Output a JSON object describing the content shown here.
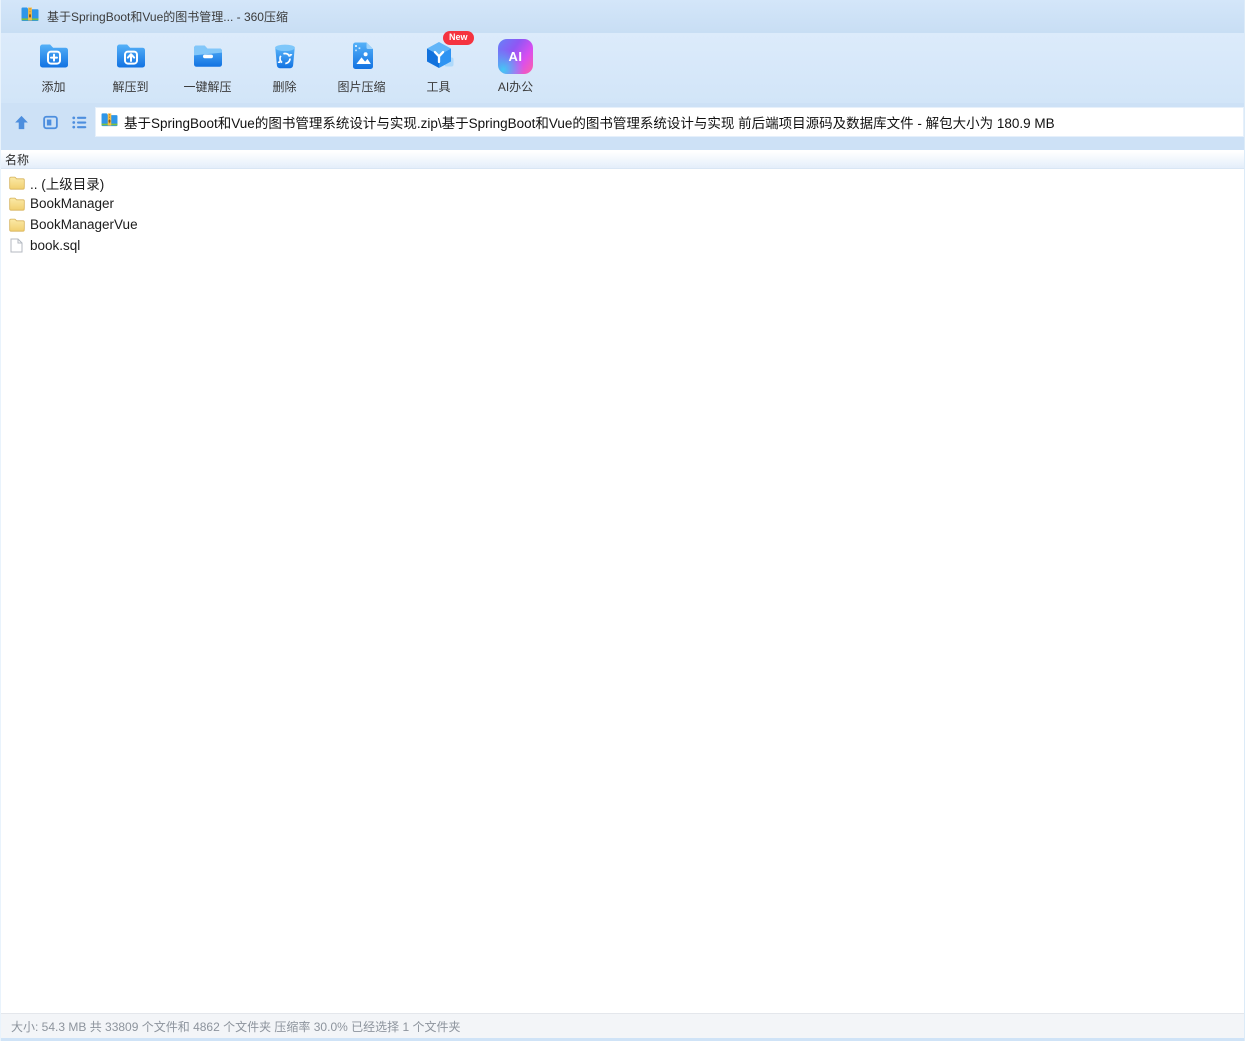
{
  "window": {
    "title": "基于SpringBoot和Vue的图书管理... - 360压缩",
    "app_name": "360压缩"
  },
  "colors": {
    "chrome_blue": "#d2e5f8",
    "toolbar_icon_blue": "#1c7ee6",
    "accent_nav_blue": "#4d8ede",
    "badge_red": "#f5333f",
    "folder_yellow": "#f5d77e",
    "status_gray": "#8d949d"
  },
  "toolbar": {
    "items": [
      {
        "label": "添加",
        "icon": "folder-plus-icon"
      },
      {
        "label": "解压到",
        "icon": "folder-extract-icon"
      },
      {
        "label": "一键解压",
        "icon": "folder-oneclick-icon"
      },
      {
        "label": "删除",
        "icon": "trash-recycle-icon"
      },
      {
        "label": "图片压缩",
        "icon": "image-compress-icon"
      },
      {
        "label": "工具",
        "icon": "tools-cube-icon"
      },
      {
        "label": "AI办公",
        "icon": "ai-office-icon"
      }
    ],
    "new_badge": "New",
    "ai_label": "AI"
  },
  "addressbar": {
    "nav_icons": [
      "up-icon",
      "folder-view-icon",
      "list-view-icon"
    ],
    "path": "基于SpringBoot和Vue的图书管理系统设计与实现.zip\\基于SpringBoot和Vue的图书管理系统设计与实现 前后端项目源码及数据库文件 - 解包大小为 180.9 MB"
  },
  "list": {
    "header": "名称",
    "files": [
      {
        "name": ".. (上级目录)",
        "type": "folder"
      },
      {
        "name": "BookManager",
        "type": "folder"
      },
      {
        "name": "BookManagerVue",
        "type": "folder"
      },
      {
        "name": "book.sql",
        "type": "file"
      }
    ]
  },
  "statusbar": {
    "text": "大小: 54.3 MB 共 33809 个文件和 4862 个文件夹 压缩率 30.0% 已经选择 1 个文件夹"
  }
}
